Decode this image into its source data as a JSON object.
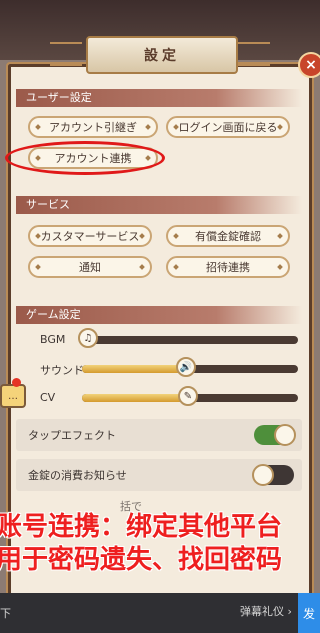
{
  "dialog": {
    "title": "設定",
    "close_glyph": "×"
  },
  "user_settings": {
    "header": "ユーザー設定",
    "buttons": {
      "transfer": "アカウント引継ぎ",
      "back_to_login": "ログイン画面に戻る",
      "account_link": "アカウント連携"
    }
  },
  "services": {
    "header": "サービス",
    "buttons": {
      "customer_service": "カスタマーサービス",
      "paid_gold_check": "有償金錠確認",
      "notice": "通知",
      "invite_link": "招待連携"
    }
  },
  "game_settings": {
    "header": "ゲーム設定",
    "sliders": [
      {
        "label": "BGM",
        "value": 0.0,
        "icon": "music-note-icon"
      },
      {
        "label": "サウンド",
        "value": 0.48,
        "icon": "speaker-icon"
      },
      {
        "label": "CV",
        "value": 0.49,
        "icon": "mic-icon"
      }
    ],
    "toggles": {
      "tap_effect": {
        "label": "タップエフェクト",
        "state": "on"
      },
      "gold_notice": {
        "label": "金錠の消費お知らせ",
        "state": "off"
      },
      "partial": {
        "label": "括で"
      }
    }
  },
  "overlay": {
    "line1": "账号连携：绑定其他平台",
    "line2": "用于密码遗失、找回密码"
  },
  "bottom": {
    "hint": "下",
    "danmaku": "弹幕礼仪 ›",
    "send": "发"
  },
  "colors": {
    "accent_red": "#e01919",
    "toggle_on": "#4e8f3b",
    "section_header": "#9b5a4a"
  }
}
